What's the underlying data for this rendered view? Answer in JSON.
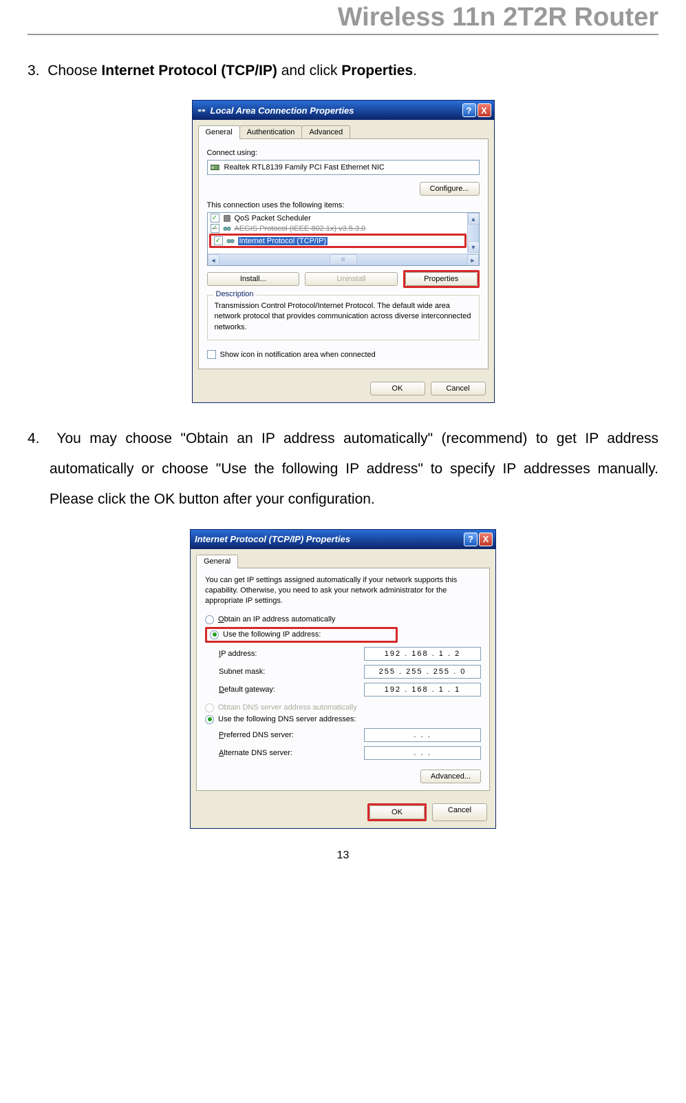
{
  "header": {
    "title": "Wireless 11n 2T2R Router"
  },
  "step3": {
    "num": "3.",
    "prefix": "Choose ",
    "bold1": "Internet Protocol (TCP/IP)",
    "mid": " and click ",
    "bold2": "Properties",
    "suffix": "."
  },
  "step4": {
    "num": "4.",
    "text": "You may choose \"Obtain an IP address automatically\" (recommend) to get IP address automatically or choose \"Use the following IP address\" to specify IP addresses manually. Please click the OK button after your configuration."
  },
  "dialog1": {
    "title": "Local Area Connection Properties",
    "tabs": [
      "General",
      "Authentication",
      "Advanced"
    ],
    "connect_using_label": "Connect using:",
    "nic": "Realtek RTL8139 Family PCI Fast Ethernet NIC",
    "configure_btn": "Configure...",
    "items_label": "This connection uses the following items:",
    "list": {
      "item1": "QoS Packet Scheduler",
      "item2": "AEGIS Protocol (IEEE 802.1x) v3.5.3.0",
      "item3": "Internet Protocol (TCP/IP)"
    },
    "install_btn": "Install...",
    "uninstall_btn": "Uninstall",
    "properties_btn": "Properties",
    "desc_legend": "Description",
    "desc_text": "Transmission Control Protocol/Internet Protocol. The default wide area network protocol that provides communication across diverse interconnected networks.",
    "show_icon": "Show icon in notification area when connected",
    "ok": "OK",
    "cancel": "Cancel"
  },
  "dialog2": {
    "title": "Internet Protocol (TCP/IP) Properties",
    "tab": "General",
    "intro": "You can get IP settings assigned automatically if your network supports this capability. Otherwise, you need to ask your network administrator for the appropriate IP settings.",
    "obtain_ip": "Obtain an IP address automatically",
    "use_ip": "Use the following IP address:",
    "ip_label": "IP address:",
    "ip_value": "192 . 168 .   1   .   2",
    "subnet_label": "Subnet mask:",
    "subnet_value": "255 . 255 . 255 .   0",
    "gateway_label": "Default gateway:",
    "gateway_value": "192 . 168 .   1   .   1",
    "obtain_dns": "Obtain DNS server address automatically",
    "use_dns": "Use the following DNS server addresses:",
    "pref_dns_label": "Preferred DNS server:",
    "pref_dns_value": ".       .       .",
    "alt_dns_label": "Alternate DNS server:",
    "alt_dns_value": ".       .       .",
    "advanced_btn": "Advanced...",
    "ok": "OK",
    "cancel": "Cancel"
  },
  "page_number": "13"
}
